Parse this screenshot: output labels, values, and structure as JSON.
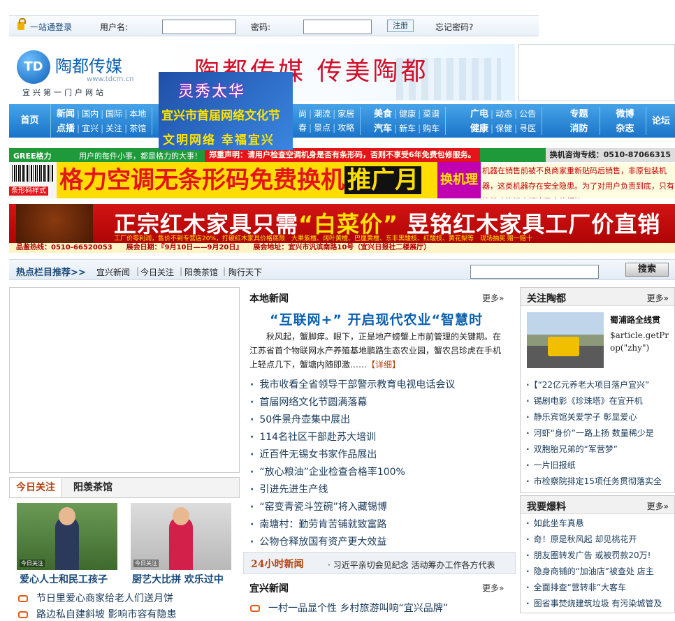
{
  "login": {
    "link": "一站通登录",
    "username_label": "用户名:",
    "username_value": "",
    "password_label": "密码:",
    "password_value": "",
    "register": "注册",
    "forgot": "忘记密码?"
  },
  "logo": {
    "badge": "TD",
    "name": "陶都传媒",
    "url": "www.tdcm.cn",
    "slogan": "宜兴第一门户网站"
  },
  "top_banner": {
    "text": "陶都传媒 传美陶都"
  },
  "float_ad": {
    "title": "灵秀太华",
    "line1": "宜兴市首届网络文化节",
    "line2": "文明网络 幸福宜兴"
  },
  "nav": {
    "home": "首页",
    "groups": [
      {
        "rows": [
          [
            "新闻",
            "国内",
            "国际",
            "本地"
          ],
          [
            "点播",
            "宜兴",
            "关注",
            "茶馆"
          ]
        ]
      },
      {
        "rows": [
          [
            "美食",
            "健康",
            "菜谱"
          ],
          [
            "汽车",
            "新车",
            "购车"
          ]
        ]
      },
      {
        "rows": [
          [
            "广电",
            "动态",
            "公告"
          ],
          [
            "健康",
            "保健",
            "寻医"
          ]
        ]
      },
      {
        "rows": [
          [
            "专题"
          ],
          [
            "消防"
          ]
        ]
      },
      {
        "rows": [
          [
            "微博"
          ],
          [
            "杂志"
          ]
        ]
      },
      {
        "rows": [
          [
            "论坛"
          ]
        ]
      }
    ],
    "partial_rows": [
      [
        "尚",
        "潮流",
        "家居"
      ],
      [
        "春",
        "景点",
        "攻略"
      ]
    ]
  },
  "gree_ad": {
    "brand": "GREE格力",
    "slogan": "用户的每件小事，都是格力的大事！",
    "notice": "郑重声明：请用户检查空调机身是否有条形码，否则不享受6年免费包修服务。",
    "hotline": "换机咨询专线：0510-87066315",
    "code_label": "条形码样式",
    "headline": "格力空调无条形码免费换机",
    "tag": "推广月",
    "reason": "换机理由",
    "desc": "机器在销售前被不良商家重新贴码后销售，非原包装机器，这类机器存在安全隐患。为了对用户负责到底，只有换机才能彻底解决用户的烦恼。"
  },
  "furniture_ad": {
    "line_a": "正宗红木家具只需",
    "line_y": "“白菜价”",
    "line_b": "昱铭红木家具工厂价直销惠",
    "sub": "工厂价零利润，售价不到专营店20%，打破红木家具价格底限",
    "species": "大果紫檀、阔叶黄檀、巴厘黄檀、东非黑酸枝、红酸枝、黄花梨等",
    "promo": "现场抽奖 赠一赔十",
    "bottom": "品鉴热线：0510-66520053　　展会日期：『9月10日——9月20日』　　展会地址：宜兴市汎滨南路10号（宜兴日报社二楼展厅）"
  },
  "hot_columns": {
    "title": "热点栏目推荐>>",
    "links": [
      "宜兴新闻",
      "今日关注",
      "阳羡茶馆",
      "陶行天下"
    ],
    "search_value": "",
    "search_button": "搜索"
  },
  "left": {
    "tabs": [
      "今日关注",
      "阳羡茶馆"
    ],
    "thumbs": [
      {
        "caption": "爱心人士和民工孩子",
        "overlay": "今日关注"
      },
      {
        "caption": "厨艺大比拼 欢乐过中",
        "overlay": "今日关注"
      }
    ],
    "links": [
      "节日里爱心商家给老人们送月饼",
      "路边私自建斜坡 影响市容有隐患"
    ]
  },
  "middle": {
    "local_title": "本地新闻",
    "more": "更多»",
    "headline": "“互联网+” 开启现代农业“智慧时",
    "summary": "秋风起，蟹脚痒。眼下，正是地产螃蟹上市前管理的关键期。在江苏省首个物联网水产养殖基地鹏路生态农业园，蟹农吕珍虎在手机上轻点几下，蟹塘内随即激……",
    "detail": "【详细】",
    "news": [
      "我市收看全省领导干部警示教育电视电话会议",
      "首届网络文化节圆满落幕",
      "50件景舟壶集中展出",
      "114名社区干部赴苏大培训",
      "近百件无锡女书家作品展出",
      "“放心粮油”企业检查合格率100%",
      "引进先进生产线",
      "“窑变青瓷斗笠碗”将入藏锡博",
      "南塘村：勤劳肯苦铺就致富路",
      "公物仓释放国有资产更大效益"
    ],
    "h24_title": "24小时新闻",
    "h24_news": "· 习近平亲切会见纪念 活动筹办工作各方代表",
    "yixing_title": "宜兴新闻",
    "yixing_news": [
      "一村一品显个性 乡村旅游叫响“宜兴品牌”"
    ]
  },
  "right": {
    "follow_title": "关注陶都",
    "more": "更多»",
    "feature_title": "蜀浦路全线贯",
    "feature_text": "$article.getProp(\"zhy\")",
    "follow_list": [
      "【“22亿元养老大项目落户宜兴”",
      "锡剧电影《珍珠塔》在宜开机",
      "静乐宾馆关爱学子 彰显爱心",
      "河虾“身价”一路上扬 数量稀少是",
      "双胞胎兄弟的“军营梦”",
      "一片旧报纸",
      "市检察院排定15项任务贯彻落实全"
    ],
    "report_title": "我要爆料",
    "report_list": [
      "如此坐车真悬",
      "奇！原是秋风起 却见桃花开",
      "朋友圈转发广告 或被罚款20万!",
      "隐身商铺的“加油店”被查处 店主",
      "全面排查“营转非”大客车",
      "图省事焚烧建筑垃圾 有污染城管及"
    ]
  }
}
